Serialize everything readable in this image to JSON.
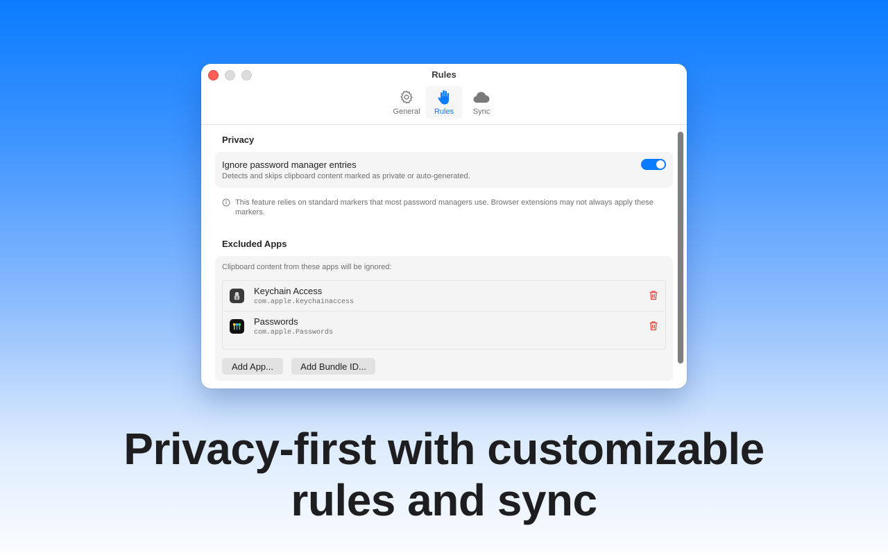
{
  "window": {
    "title": "Rules"
  },
  "tabs": [
    {
      "label": "General",
      "icon": "gear-icon"
    },
    {
      "label": "Rules",
      "icon": "hand-icon"
    },
    {
      "label": "Sync",
      "icon": "cloud-icon"
    }
  ],
  "privacy": {
    "section_title": "Privacy",
    "setting_title": "Ignore password manager entries",
    "setting_desc": "Detects and skips clipboard content marked as private or auto-generated.",
    "toggle_on": true,
    "note": "This feature relies on standard markers that most password managers use. Browser extensions may not always apply these markers."
  },
  "excluded": {
    "section_title": "Excluded Apps",
    "desc": "Clipboard content from these apps will be ignored:",
    "apps": [
      {
        "name": "Keychain Access",
        "bundle_id": "com.apple.keychainaccess",
        "icon": "keychain-icon"
      },
      {
        "name": "Passwords",
        "bundle_id": "com.apple.Passwords",
        "icon": "passwords-icon"
      }
    ],
    "add_app_label": "Add App...",
    "add_bundle_label": "Add Bundle ID..."
  },
  "headline": {
    "line1": "Privacy-first with customizable",
    "line2": "rules and sync"
  },
  "colors": {
    "accent": "#0a7aff",
    "destructive": "#e8453c",
    "close": "#ff5f57"
  }
}
